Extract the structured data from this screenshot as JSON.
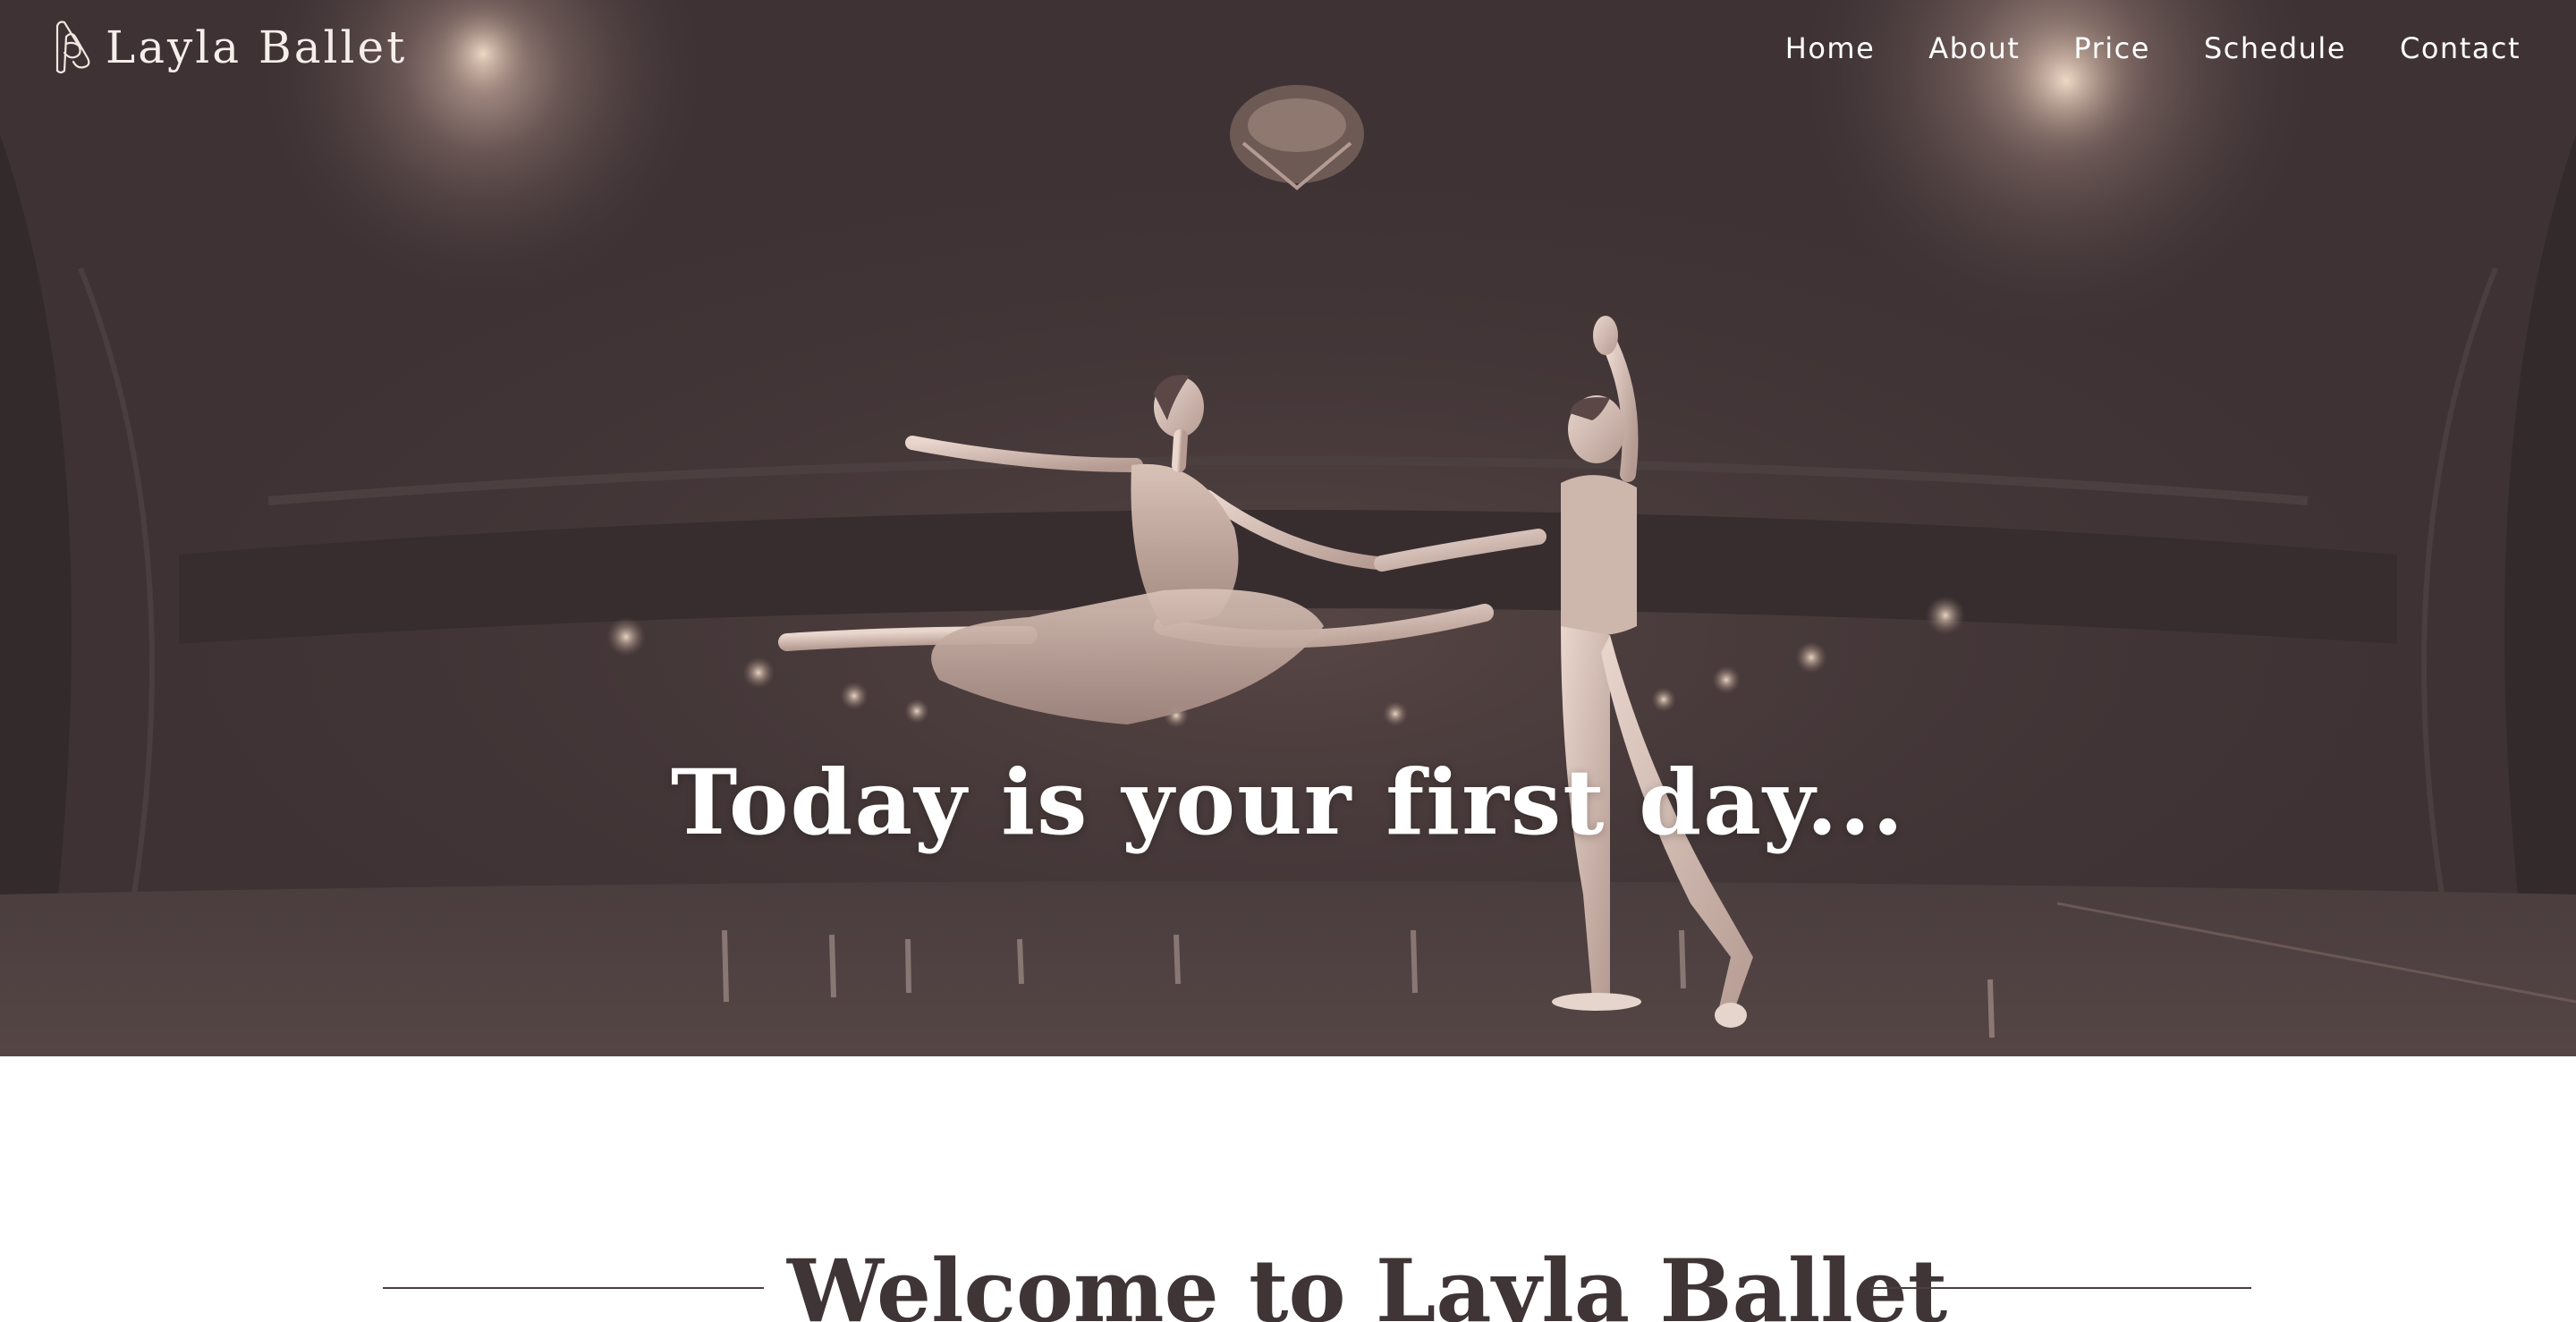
{
  "brand": {
    "name": "Layla Ballet",
    "logo_icon": "ballet-shoes-icon"
  },
  "nav": {
    "items": [
      {
        "label": "Home"
      },
      {
        "label": "About"
      },
      {
        "label": "Price"
      },
      {
        "label": "Schedule"
      },
      {
        "label": "Contact"
      }
    ]
  },
  "hero": {
    "headline": "Today is your first day...",
    "overlay_color": "#3f3436"
  },
  "welcome": {
    "title": "Welcome to Layla Ballet"
  },
  "colors": {
    "primary_dark": "#3f3436",
    "text_light": "#ffffff"
  }
}
